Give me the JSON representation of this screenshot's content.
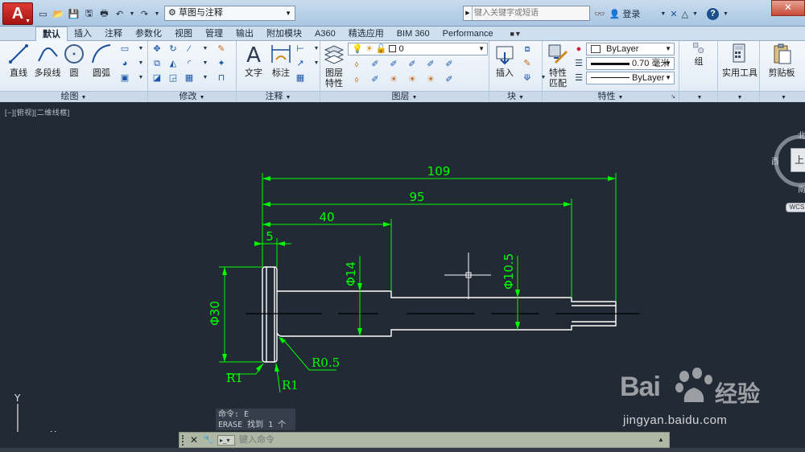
{
  "titlebar": {
    "logo_letter": "A",
    "workspace": "草图与注释",
    "search_placeholder": "键入关键字或短语",
    "login": "登录"
  },
  "tabs": [
    {
      "label": "默认",
      "active": true
    },
    {
      "label": "插入"
    },
    {
      "label": "注释"
    },
    {
      "label": "参数化"
    },
    {
      "label": "视图"
    },
    {
      "label": "管理"
    },
    {
      "label": "输出"
    },
    {
      "label": "附加模块"
    },
    {
      "label": "A360"
    },
    {
      "label": "精选应用"
    },
    {
      "label": "BIM 360"
    },
    {
      "label": "Performance"
    }
  ],
  "ribbon": {
    "draw": {
      "title": "绘图",
      "line": "直线",
      "polyline": "多段线",
      "circle": "圆",
      "arc": "圆弧"
    },
    "modify": {
      "title": "修改"
    },
    "annotation": {
      "title": "注释",
      "text": "文字",
      "dimension": "标注"
    },
    "layers": {
      "title": "图层",
      "layer_props": "图层\n特性",
      "layer_props_1": "图层",
      "layer_props_2": "特性",
      "current_layer": "0"
    },
    "block": {
      "title": "块",
      "insert": "插入"
    },
    "properties": {
      "title": "特性",
      "match_1": "特性",
      "match_2": "匹配",
      "color": "ByLayer",
      "lineweight": "0.70 毫米",
      "linetype": "ByLayer"
    },
    "groups": {
      "title": "组"
    },
    "utilities": {
      "title": "实用工具"
    },
    "clipboard": {
      "title": "剪贴板"
    }
  },
  "viewport": {
    "label": "[−][俯视][二维线框]"
  },
  "viewcube": {
    "north": "北",
    "west": "西",
    "south": "南",
    "top": "上",
    "wcs": "WCS"
  },
  "drawing": {
    "dimensions": {
      "d109": "109",
      "d95": "95",
      "d40": "40",
      "d5": "5",
      "dia30": "Φ30",
      "dia14": "Φ14",
      "dia10_5": "Φ10.5",
      "r05": "R0.5",
      "r1_left": "R1",
      "r1_right": "R1"
    },
    "ucs": {
      "x": "X",
      "y": "Y"
    }
  },
  "command": {
    "history_1": "命令: E",
    "history_2": "ERASE 找到 1 个",
    "placeholder": "键入命令"
  },
  "watermark": {
    "brand": "Bai",
    "brand2": "经验",
    "url": "jingyan.baidu.com"
  },
  "colors": {
    "dimension": "#00ff00",
    "geometry": "#ffffff",
    "background": "#222a35"
  }
}
